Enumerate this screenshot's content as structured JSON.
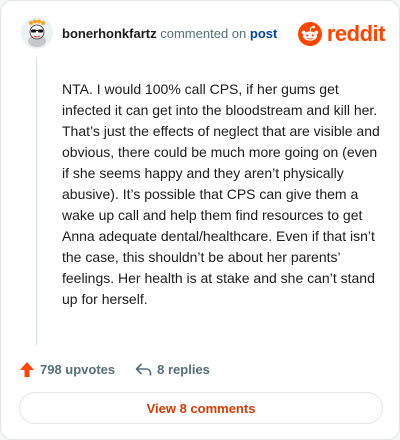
{
  "header": {
    "username": "bonerhonkfartz",
    "action_text": "commented on",
    "post_link": "post",
    "brand": "reddit"
  },
  "comment": {
    "body": "NTA. I would 100% call CPS, if her gums get infected it can get into the bloodstream and kill her. That’s just the effects of neglect that are visible and obvious, there could be much more going on (even if she seems happy and they aren’t physically abusive). It’s possible that CPS can give them a wake up call and help them find resources to get Anna adequate dental/healthcare. Even if that isn’t the case, this shouldn’t be about her parents’ feelings. Her health is at stake and she can’t stand up for herself."
  },
  "actions": {
    "upvotes_label": "798 upvotes",
    "replies_label": "8 replies"
  },
  "footer": {
    "view_comments_label": "View 8 comments"
  },
  "colors": {
    "brand": "#ff4500",
    "link": "#0045ac",
    "view_button_text": "#d93a00"
  }
}
